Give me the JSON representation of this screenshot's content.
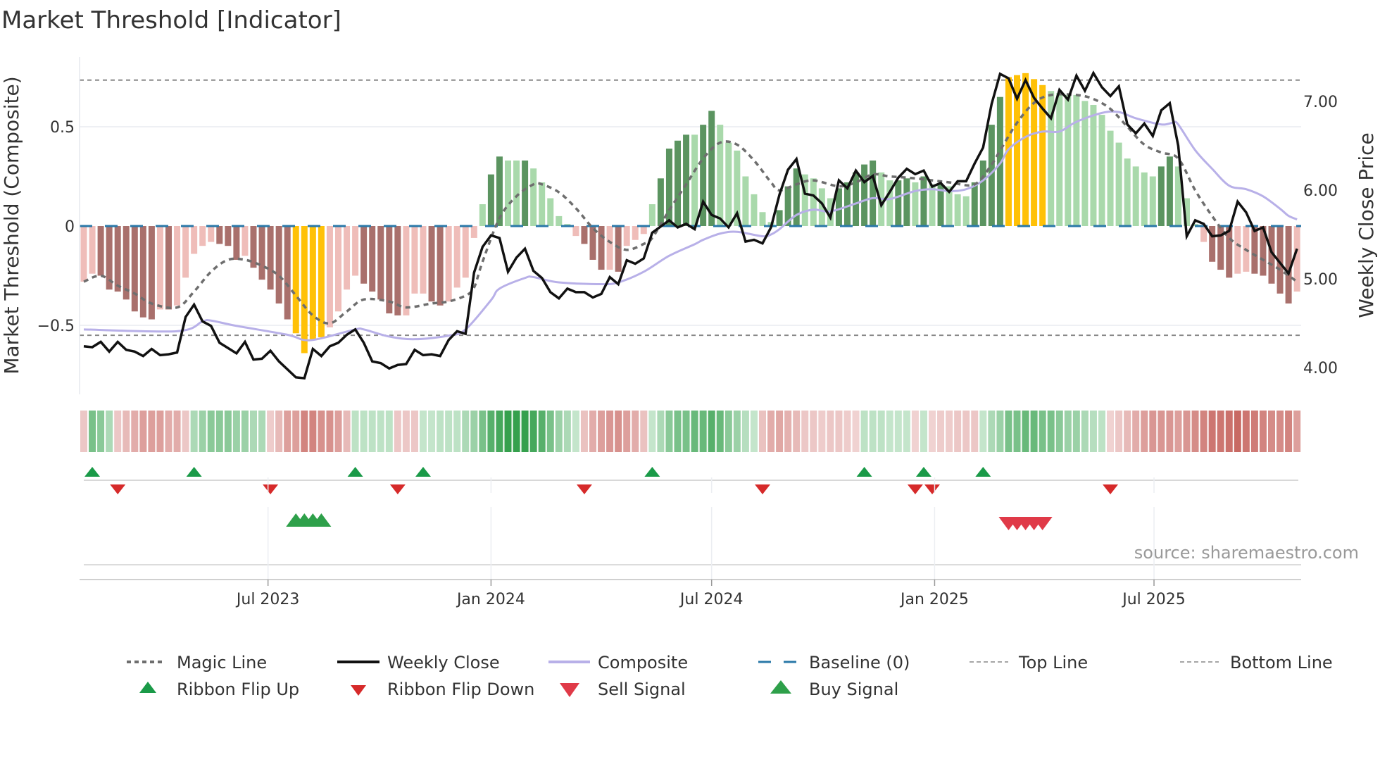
{
  "title": "Market Threshold [Indicator]",
  "source": "source: sharemaestro.com",
  "chart_data": {
    "type": "bar",
    "title": "Market Threshold [Indicator]",
    "start_date": "2023-01-30",
    "step_days": 7,
    "left_axis": {
      "label": "Market Threshold (Composite)",
      "range": [
        -0.85,
        0.85
      ],
      "ticks": [
        0.5,
        0,
        -0.5
      ],
      "tick_labels": [
        "0.5",
        "0",
        "−0.5"
      ]
    },
    "right_axis": {
      "label": "Weekly Close Price",
      "range": [
        3.65,
        7.55
      ],
      "ticks": [
        7,
        6,
        5,
        4
      ],
      "tick_labels": [
        "7.00",
        "6.00",
        "5.00",
        "4.00"
      ]
    },
    "x_ticks": [
      {
        "date": "2023-07-01",
        "label": "Jul 2023"
      },
      {
        "date": "2024-01-01",
        "label": "Jan 2024"
      },
      {
        "date": "2024-07-01",
        "label": "Jul 2024"
      },
      {
        "date": "2025-01-01",
        "label": "Jan 2025"
      },
      {
        "date": "2025-07-01",
        "label": "Jul 2025"
      }
    ],
    "top_line": 0.735,
    "bottom_line": -0.55,
    "baseline": 0,
    "grid": true,
    "composite_bars": [
      -0.28,
      -0.24,
      -0.25,
      -0.32,
      -0.33,
      -0.37,
      -0.43,
      -0.46,
      -0.47,
      -0.42,
      -0.42,
      -0.4,
      -0.26,
      -0.14,
      -0.1,
      -0.08,
      -0.09,
      -0.1,
      -0.17,
      -0.15,
      -0.21,
      -0.27,
      -0.32,
      -0.39,
      -0.47,
      -0.54,
      -0.64,
      -0.57,
      -0.56,
      -0.51,
      -0.43,
      -0.32,
      -0.25,
      -0.29,
      -0.33,
      -0.37,
      -0.44,
      -0.45,
      -0.45,
      -0.34,
      -0.34,
      -0.38,
      -0.4,
      -0.38,
      -0.31,
      -0.26,
      -0.06,
      0.11,
      0.26,
      0.35,
      0.33,
      0.33,
      0.33,
      0.29,
      0.22,
      0.14,
      0.05,
      0.01,
      -0.05,
      -0.09,
      -0.17,
      -0.22,
      -0.22,
      -0.23,
      -0.1,
      -0.07,
      -0.04,
      0.11,
      0.24,
      0.39,
      0.43,
      0.46,
      0.46,
      0.51,
      0.58,
      0.51,
      0.42,
      0.38,
      0.25,
      0.16,
      0.07,
      0.02,
      0.08,
      0.2,
      0.29,
      0.26,
      0.24,
      0.19,
      0.14,
      0.19,
      0.22,
      0.27,
      0.31,
      0.33,
      0.27,
      0.23,
      0.23,
      0.24,
      0.22,
      0.25,
      0.21,
      0.21,
      0.2,
      0.16,
      0.15,
      0.22,
      0.33,
      0.51,
      0.65,
      0.75,
      0.76,
      0.77,
      0.74,
      0.71,
      0.68,
      0.67,
      0.66,
      0.66,
      0.63,
      0.61,
      0.56,
      0.48,
      0.42,
      0.34,
      0.3,
      0.27,
      0.25,
      0.3,
      0.35,
      0.3,
      0.14,
      0.01,
      -0.08,
      -0.18,
      -0.22,
      -0.26,
      -0.24,
      -0.23,
      -0.24,
      -0.25,
      -0.29,
      -0.34,
      -0.39,
      -0.33
    ],
    "bar_shades": "LLDDDDDDDLDLLLLLDDDLDDDDDYYYYLLLLDDDDDLLLDDLLLLLDDLLDLLLLLLDDDLDLLLLDDDDLDDLLLLLLLDDDLLLLDDDDDLLDDLDLDLLLDDDDYYYYYLLLLLLLLLLLLLDDLLLLDDDLLDDDDDL",
    "weekly_close": [
      4.24,
      4.23,
      4.29,
      4.18,
      4.29,
      4.2,
      4.18,
      4.13,
      4.21,
      4.14,
      4.15,
      4.17,
      4.57,
      4.71,
      4.52,
      4.47,
      4.28,
      4.22,
      4.16,
      4.29,
      4.09,
      4.1,
      4.19,
      4.07,
      3.98,
      3.89,
      3.88,
      4.21,
      4.13,
      4.24,
      4.28,
      4.37,
      4.43,
      4.28,
      4.07,
      4.05,
      3.99,
      4.03,
      4.04,
      4.2,
      4.14,
      4.15,
      4.13,
      4.31,
      4.41,
      4.38,
      5.07,
      5.36,
      5.49,
      5.46,
      5.08,
      5.24,
      5.34,
      5.09,
      5.01,
      4.85,
      4.78,
      4.89,
      4.85,
      4.85,
      4.79,
      4.83,
      5.02,
      4.94,
      5.21,
      5.17,
      5.23,
      5.52,
      5.59,
      5.66,
      5.58,
      5.62,
      5.56,
      5.87,
      5.72,
      5.68,
      5.58,
      5.74,
      5.42,
      5.44,
      5.4,
      5.58,
      5.95,
      6.23,
      6.35,
      5.96,
      5.94,
      5.85,
      5.69,
      6.11,
      6.02,
      6.22,
      6.09,
      6.16,
      5.83,
      5.98,
      6.14,
      6.24,
      6.18,
      6.22,
      6.04,
      6.08,
      5.98,
      6.1,
      6.1,
      6.3,
      6.48,
      6.97,
      7.31,
      7.26,
      7.03,
      7.24,
      7.04,
      6.92,
      6.81,
      7.13,
      7.02,
      7.29,
      7.12,
      7.32,
      7.16,
      7.06,
      7.17,
      6.74,
      6.64,
      6.75,
      6.61,
      6.9,
      6.98,
      6.5,
      5.48,
      5.66,
      5.62,
      5.48,
      5.49,
      5.54,
      5.87,
      5.75,
      5.54,
      5.58,
      5.3,
      5.18,
      5.06,
      5.34
    ],
    "composite_line_price_axis": [
      [
        1,
        4.43
      ],
      [
        12,
        4.41
      ],
      [
        15,
        4.52
      ],
      [
        16,
        4.53
      ],
      [
        19,
        4.47
      ],
      [
        25,
        4.37
      ],
      [
        27,
        4.31
      ],
      [
        29,
        4.33
      ],
      [
        33,
        4.43
      ],
      [
        34,
        4.43
      ],
      [
        37,
        4.35
      ],
      [
        40,
        4.32
      ],
      [
        44,
        4.36
      ],
      [
        46,
        4.43
      ],
      [
        49,
        4.76
      ],
      [
        50,
        4.89
      ],
      [
        53,
        5.01
      ],
      [
        54,
        5.02
      ],
      [
        57,
        4.96
      ],
      [
        62,
        4.94
      ],
      [
        64,
        4.96
      ],
      [
        67,
        5.08
      ],
      [
        70,
        5.26
      ],
      [
        73,
        5.39
      ],
      [
        74,
        5.44
      ],
      [
        76,
        5.51
      ],
      [
        78,
        5.53
      ],
      [
        81,
        5.48
      ],
      [
        82,
        5.5
      ],
      [
        83,
        5.56
      ],
      [
        85,
        5.72
      ],
      [
        87,
        5.78
      ],
      [
        89,
        5.76
      ],
      [
        92,
        5.85
      ],
      [
        94,
        5.91
      ],
      [
        96,
        5.9
      ],
      [
        99,
        5.99
      ],
      [
        101,
        6.01
      ],
      [
        103,
        5.99
      ],
      [
        105,
        6.01
      ],
      [
        107,
        6.11
      ],
      [
        109,
        6.3
      ],
      [
        110,
        6.46
      ],
      [
        112,
        6.6
      ],
      [
        114,
        6.66
      ],
      [
        116,
        6.66
      ],
      [
        118,
        6.77
      ],
      [
        121,
        6.87
      ],
      [
        123,
        6.88
      ],
      [
        125,
        6.81
      ],
      [
        128,
        6.74
      ],
      [
        129.4,
        6.76
      ],
      [
        130,
        6.74
      ],
      [
        132,
        6.45
      ],
      [
        134,
        6.24
      ],
      [
        136,
        6.05
      ],
      [
        138,
        6.01
      ],
      [
        140,
        5.93
      ],
      [
        142,
        5.79
      ],
      [
        143,
        5.71
      ],
      [
        144,
        5.67
      ]
    ],
    "magic_line": [
      [
        1,
        -0.28
      ],
      [
        3,
        -0.25
      ],
      [
        5,
        -0.3
      ],
      [
        7,
        -0.34
      ],
      [
        9,
        -0.39
      ],
      [
        12,
        -0.41
      ],
      [
        14,
        -0.33
      ],
      [
        16,
        -0.23
      ],
      [
        18,
        -0.17
      ],
      [
        20,
        -0.17
      ],
      [
        22,
        -0.2
      ],
      [
        24,
        -0.25
      ],
      [
        26,
        -0.35
      ],
      [
        28,
        -0.45
      ],
      [
        30,
        -0.49
      ],
      [
        32,
        -0.43
      ],
      [
        34,
        -0.37
      ],
      [
        37,
        -0.38
      ],
      [
        39,
        -0.41
      ],
      [
        42,
        -0.39
      ],
      [
        44,
        -0.38
      ],
      [
        46,
        -0.35
      ],
      [
        47,
        -0.31
      ],
      [
        48,
        -0.18
      ],
      [
        50,
        0.04
      ],
      [
        52,
        0.15
      ],
      [
        54,
        0.21
      ],
      [
        55,
        0.21
      ],
      [
        57,
        0.17
      ],
      [
        59,
        0.09
      ],
      [
        61,
        -0.01
      ],
      [
        63,
        -0.08
      ],
      [
        65,
        -0.12
      ],
      [
        67,
        -0.09
      ],
      [
        68,
        -0.06
      ],
      [
        70,
        0.08
      ],
      [
        72,
        0.21
      ],
      [
        74,
        0.34
      ],
      [
        76,
        0.42
      ],
      [
        78,
        0.41
      ],
      [
        80,
        0.33
      ],
      [
        82,
        0.22
      ],
      [
        83,
        0.18
      ],
      [
        85,
        0.21
      ],
      [
        87,
        0.23
      ],
      [
        90,
        0.2
      ],
      [
        92,
        0.22
      ],
      [
        94,
        0.26
      ],
      [
        96,
        0.25
      ],
      [
        99,
        0.24
      ],
      [
        103,
        0.22
      ],
      [
        106,
        0.21
      ],
      [
        108,
        0.31
      ],
      [
        109,
        0.38
      ],
      [
        111,
        0.52
      ],
      [
        113,
        0.62
      ],
      [
        115,
        0.66
      ],
      [
        118,
        0.66
      ],
      [
        120,
        0.64
      ],
      [
        122,
        0.59
      ],
      [
        124,
        0.5
      ],
      [
        126,
        0.41
      ],
      [
        128,
        0.37
      ],
      [
        130,
        0.34
      ],
      [
        132,
        0.18
      ],
      [
        134,
        0.05
      ],
      [
        136,
        -0.06
      ],
      [
        138,
        -0.12
      ],
      [
        140,
        -0.17
      ],
      [
        142,
        -0.22
      ],
      [
        144,
        -0.28
      ]
    ],
    "ribbon_strength": [
      -1,
      3,
      2.5,
      1.5,
      -1,
      -1.5,
      -2,
      -2.5,
      -2.5,
      -2.5,
      -2,
      -2,
      -1,
      1.5,
      2,
      2.5,
      2.5,
      2.5,
      2,
      2,
      1.5,
      1.5,
      -0.8,
      -1.5,
      -2.5,
      -2.5,
      -3.5,
      -3.5,
      -3,
      -3,
      -2.5,
      -1.5,
      1,
      1,
      1,
      1,
      1,
      -1,
      -1,
      -1,
      0.8,
      0.8,
      1,
      1,
      1,
      1.5,
      2,
      3,
      4,
      4.5,
      5,
      5,
      5,
      4.5,
      4,
      3,
      2,
      1.5,
      0.8,
      -1.2,
      -2,
      -2.5,
      -2.8,
      -3,
      -2.5,
      -2,
      -1.2,
      0.8,
      1.5,
      2.5,
      3,
      3,
      3.5,
      3.5,
      4,
      3.5,
      2.5,
      2,
      1.2,
      0.8,
      -1.2,
      -2,
      -2.2,
      -1.8,
      -1.5,
      -1,
      -1,
      -0.8,
      -1,
      -1,
      -0.8,
      -0.6,
      1,
      1,
      1,
      0.8,
      0.8,
      0.8,
      -0.6,
      0.8,
      -0.6,
      -0.8,
      -0.8,
      -1,
      -1,
      -1,
      0.8,
      1.5,
      2,
      3,
      3,
      3.5,
      3.5,
      3,
      3,
      2.5,
      2,
      2,
      1.5,
      1.2,
      1,
      -0.6,
      -1,
      -1.5,
      -2,
      -2.5,
      -2.8,
      -2.8,
      -2.8,
      -2.5,
      -2.8,
      -3.2,
      -3.5,
      -4,
      -4,
      -4.2,
      -4.5,
      -4,
      -3.8,
      -3.5,
      -3.2,
      -3.2,
      -3.5,
      -2.5
    ],
    "ribbon_flip_up": [
      2,
      14,
      33,
      41,
      68,
      93,
      100,
      107
    ],
    "ribbon_flip_down": [
      5,
      23,
      38,
      60,
      81,
      99,
      101,
      122
    ],
    "buy_signals": [
      26,
      27,
      28,
      29
    ],
    "sell_signals": [
      110,
      111,
      112,
      113,
      114
    ],
    "colors": {
      "bar_pos_strong": "#5b9460",
      "bar_pos_weak": "#a9d9ab",
      "bar_neg_strong": "#a9706c",
      "bar_neg_weak": "#efbdb9",
      "bar_extreme": "#ffc107",
      "close": "#111111",
      "composite": "#b8b0e8",
      "magic": "#6e6e6e",
      "baseline": "#2a78a8",
      "threshold": "#888888",
      "flip_up": "#1a9a48",
      "flip_down": "#d62a2a",
      "buy": "#2ea04a",
      "sell": "#e03a48"
    },
    "legend": [
      {
        "label": "Magic Line",
        "kind": "dotted"
      },
      {
        "label": "Weekly Close",
        "kind": "line"
      },
      {
        "label": "Composite",
        "kind": "lavender"
      },
      {
        "label": "Baseline (0)",
        "kind": "dashed"
      },
      {
        "label": "Top Line",
        "kind": "thin-dashed"
      },
      {
        "label": "Bottom Line",
        "kind": "thin-dashed"
      },
      {
        "label": "Ribbon Flip Up",
        "kind": "up"
      },
      {
        "label": "Ribbon Flip Down",
        "kind": "down"
      },
      {
        "label": "Sell Signal",
        "kind": "sell"
      },
      {
        "label": "Buy Signal",
        "kind": "buy"
      }
    ],
    "legend_placement": "bottom"
  }
}
